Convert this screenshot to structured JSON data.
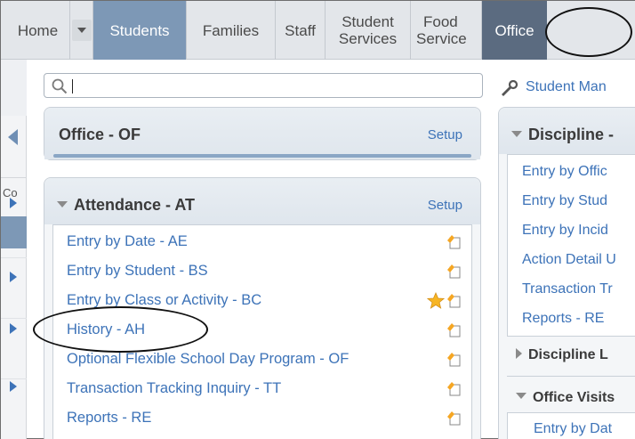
{
  "nav": {
    "tabs": [
      {
        "label": "Home"
      },
      {
        "label": "Students"
      },
      {
        "label": "Families"
      },
      {
        "label": "Staff"
      },
      {
        "label_line1": "Student",
        "label_line2": "Services"
      },
      {
        "label_line1": "Food",
        "label_line2": "Service"
      },
      {
        "label": "Office"
      }
    ]
  },
  "rail": {
    "label": "Co"
  },
  "search": {
    "value": "",
    "icon": "search-icon"
  },
  "toolbar": {
    "student_management": "Student Man"
  },
  "office_panel": {
    "title": "Office - OF",
    "setup": "Setup"
  },
  "attendance_panel": {
    "title": "Attendance - AT",
    "setup": "Setup",
    "items": [
      {
        "label": "Entry by Date - AE"
      },
      {
        "label": "Entry by Student - BS"
      },
      {
        "label": "Entry by Class or Activity - BC"
      },
      {
        "label": "History - AH"
      },
      {
        "label": "Optional Flexible School Day Program - OF"
      },
      {
        "label": "Transaction Tracking Inquiry - TT"
      },
      {
        "label": "Reports - RE"
      }
    ]
  },
  "discipline_panel": {
    "title": "Discipline -",
    "items": [
      {
        "label": "Entry by Offic"
      },
      {
        "label": "Entry by Stud"
      },
      {
        "label": "Entry by Incid"
      },
      {
        "label": "Action Detail U"
      },
      {
        "label": "Transaction Tr"
      },
      {
        "label": "Reports - RE"
      }
    ],
    "section_collapsed": "Discipline L",
    "section_expanded": "Office Visits",
    "office_visits_item": "Entry by Dat"
  },
  "colors": {
    "link": "#3d73b8",
    "nav_active": "#7d98b6",
    "nav_office": "#5b6b80"
  }
}
